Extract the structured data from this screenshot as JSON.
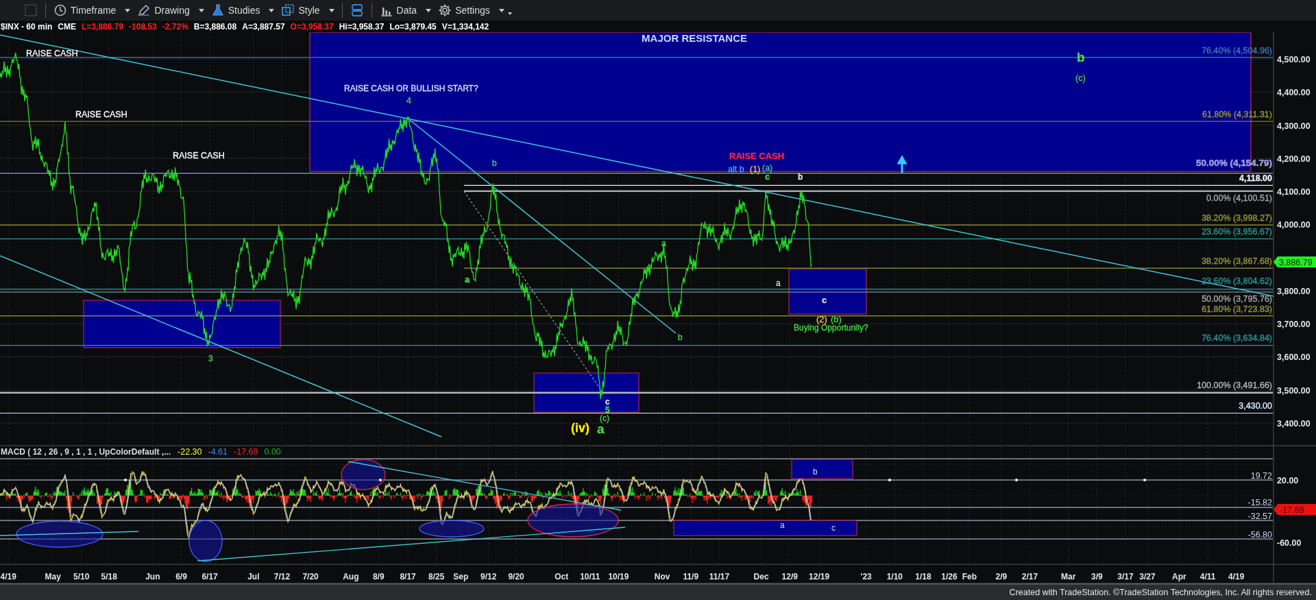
{
  "toolbar": {
    "items": [
      {
        "kind": "select"
      },
      {
        "kind": "separator"
      },
      {
        "kind": "timeframe",
        "label": "Timeframe"
      },
      {
        "kind": "drawing",
        "label": "Drawing"
      },
      {
        "kind": "studies",
        "label": "Studies"
      },
      {
        "kind": "style",
        "label": "Style"
      },
      {
        "kind": "separator"
      },
      {
        "kind": "layout"
      },
      {
        "kind": "separator"
      },
      {
        "kind": "data",
        "label": "Data"
      },
      {
        "kind": "settings",
        "label": "Settings"
      },
      {
        "kind": "more"
      }
    ]
  },
  "quote": {
    "fields": [
      {
        "text": "$INX - 60 min",
        "color": "#ffffff"
      },
      {
        "text": "CME",
        "color": "#ffffff"
      },
      {
        "text": "L=3,886.79",
        "color": "#ff2222"
      },
      {
        "text": "-108.53",
        "color": "#ff2222"
      },
      {
        "text": "-2.72%",
        "color": "#ff2222"
      },
      {
        "text": "B=3,886.08",
        "color": "#ffffff"
      },
      {
        "text": "A=3,887.57",
        "color": "#ffffff"
      },
      {
        "text": "O=3,958.37",
        "color": "#ff2222"
      },
      {
        "text": "Hi=3,958.37",
        "color": "#ffffff"
      },
      {
        "text": "Lo=3,879.45",
        "color": "#ffffff"
      },
      {
        "text": "V=1,334,142",
        "color": "#ffffff"
      }
    ]
  },
  "price_panel": {
    "title": "MAJOR RESISTANCE",
    "annotations": [
      {
        "text": "RAISE CASH",
        "color": "#ffffff"
      },
      {
        "text": "b",
        "color": "#44dd44"
      },
      {
        "text": "(c)",
        "color": "#44dd44"
      },
      {
        "text": "RAISE CASH OR BULLISH START?",
        "color": "#dde0ff"
      },
      {
        "text": "4",
        "color": "#44dd44"
      },
      {
        "text": "RAISE CASH",
        "color": "#ffffff"
      },
      {
        "text": "RAISE CASH",
        "color": "#ffffff"
      },
      {
        "text": "RAISE CASH",
        "color": "#ff2244"
      },
      {
        "text": "b",
        "color": "#44dd44"
      },
      {
        "text": "alt b",
        "color": "#44aaff"
      },
      {
        "text": "(1)",
        "color": "#ffcc33"
      },
      {
        "text": "(a)",
        "color": "#33cc99"
      },
      {
        "text": "c",
        "color": "#44dd44"
      },
      {
        "text": "b",
        "color": "#dddddd"
      },
      {
        "text": "a",
        "color": "#44dd44"
      },
      {
        "text": "a",
        "color": "#44dd44"
      },
      {
        "text": "a",
        "color": "#dddddd"
      },
      {
        "text": "c",
        "color": "#dddddd"
      },
      {
        "text": "(2)",
        "color": "#ffcc33"
      },
      {
        "text": "(b)",
        "color": "#44dd44"
      },
      {
        "text": "Buying Opportunity?",
        "color": "#44dd44"
      },
      {
        "text": "b",
        "color": "#44dd44"
      },
      {
        "text": "3",
        "color": "#44dd44"
      },
      {
        "text": "c",
        "color": "#dddddd"
      },
      {
        "text": "5",
        "color": "#44dd44"
      },
      {
        "text": "(c)",
        "color": "#44dd44"
      },
      {
        "text": "(iv)",
        "color": "#ffee00"
      },
      {
        "text": "a",
        "color": "#44dd44"
      }
    ],
    "fib_levels": [
      {
        "text": "76.40% (4,504.96)",
        "color": "#3a78b8"
      },
      {
        "text": "61.80% (4,311.31)",
        "color": "#9a9a3a"
      },
      {
        "text": "50.00% (4,154.79)",
        "color": "#9a98e0"
      },
      {
        "text": "4,118.00",
        "color": "#e8f0ff"
      },
      {
        "text": "0.00% (4,100.51)",
        "color": "#a8a8a8"
      },
      {
        "text": "38.20% (3,998.27)",
        "color": "#9a9a3a"
      },
      {
        "text": "23.60% (3,956.67)",
        "color": "#2a9a9a"
      },
      {
        "text": "38.20% (3,867.68)",
        "color": "#9a9a3a"
      },
      {
        "text": "23.60% (3,804.62)",
        "color": "#2a9a9a"
      },
      {
        "text": "50.00% (3,795.76)",
        "color": "#a8a8a8"
      },
      {
        "text": "61.80% (3,723.83)",
        "color": "#9a9a3a"
      },
      {
        "text": "76.40% (3,634.84)",
        "color": "#2a9a9a"
      },
      {
        "text": "100.00% (3,491.66)",
        "color": "#b8b8b8"
      },
      {
        "text": "3,430.00",
        "color": "#d8e8ff"
      }
    ],
    "price_axis": [
      "4,500.00",
      "4,400.00",
      "4,300.00",
      "4,200.00",
      "4,100.00",
      "4,000.00",
      "3,800.00",
      "3,700.00",
      "3,600.00",
      "3,500.00",
      "3,400.00"
    ],
    "last_price": "3,886.79"
  },
  "macd_panel": {
    "legend": "MACD ( 12 , 26 , 9 , 1 , 1 , UpColorDefault ,...",
    "values": [
      {
        "text": "-22.30",
        "color": "#ffff33"
      },
      {
        "text": "-4.61",
        "color": "#3a8aff"
      },
      {
        "text": "-17.69",
        "color": "#ff2222"
      },
      {
        "text": "0.00",
        "color": "#22bb22"
      }
    ],
    "annotations": [
      {
        "text": "b"
      },
      {
        "text": "a"
      },
      {
        "text": "c"
      }
    ],
    "levels": [
      "19.72",
      "-15.82",
      "-32.57",
      "-56.80"
    ],
    "axis": [
      "20.00",
      "-60.00"
    ],
    "last_value": "-17.69"
  },
  "date_axis": [
    "4/19",
    "May",
    "5/10",
    "5/18",
    "Jun",
    "6/9",
    "6/17",
    "Jul",
    "7/12",
    "7/20",
    "Aug",
    "8/9",
    "8/17",
    "8/25",
    "Sep",
    "9/12",
    "9/20",
    "Oct",
    "10/11",
    "10/19",
    "Nov",
    "11/9",
    "11/17",
    "Dec",
    "12/9",
    "12/19",
    "'23",
    "1/10",
    "1/18",
    "1/26",
    "Feb",
    "2/9",
    "2/17",
    "Mar",
    "3/9",
    "3/17",
    "3/27",
    "Apr",
    "4/11",
    "4/19"
  ],
  "footer": "Created with TradeStation. ©TradeStation Technologies, Inc. All rights reserved."
}
